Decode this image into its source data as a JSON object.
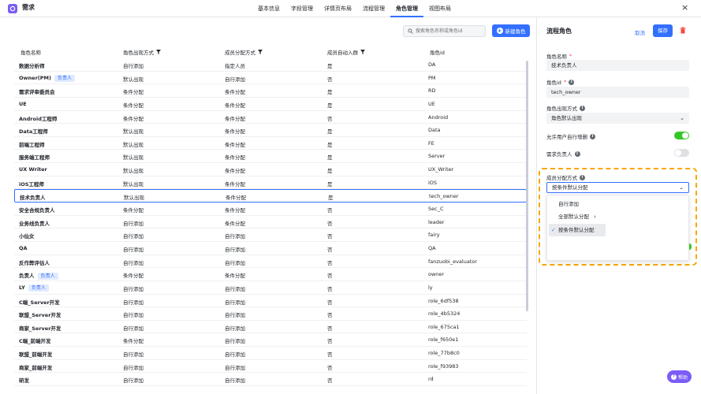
{
  "app": {
    "title": "需求"
  },
  "tabs": [
    {
      "label": "基本信息"
    },
    {
      "label": "字段管理"
    },
    {
      "label": "详情页布局"
    },
    {
      "label": "流程管理"
    },
    {
      "label": "角色管理"
    },
    {
      "label": "视图布局"
    }
  ],
  "active_tab": "角色管理",
  "toolbar": {
    "search_placeholder": "搜索角色名称或角色id",
    "new_role_label": "新建角色"
  },
  "table": {
    "columns": [
      "角色名称",
      "角色出现方式",
      "成员分配方式",
      "成员自动入群",
      "角色id"
    ],
    "rows": [
      {
        "name": "数据分析师",
        "tag": "",
        "appear": "自行添加",
        "assign": "指定人员",
        "auto": "是",
        "id": "DA"
      },
      {
        "name": "Owner(PM)",
        "tag": "负责人",
        "appear": "默认出现",
        "assign": "自行添加",
        "auto": "否",
        "id": "PM"
      },
      {
        "name": "需求评审委员会",
        "tag": "",
        "appear": "条件分配",
        "assign": "条件分配",
        "auto": "是",
        "id": "RD"
      },
      {
        "name": "UE",
        "tag": "",
        "appear": "条件分配",
        "assign": "条件分配",
        "auto": "是",
        "id": "UE"
      },
      {
        "name": "Android工程师",
        "tag": "",
        "appear": "条件分配",
        "assign": "条件分配",
        "auto": "否",
        "id": "Android"
      },
      {
        "name": "Data工程师",
        "tag": "",
        "appear": "默认出现",
        "assign": "条件分配",
        "auto": "是",
        "id": "Data"
      },
      {
        "name": "前端工程师",
        "tag": "",
        "appear": "默认出现",
        "assign": "条件分配",
        "auto": "是",
        "id": "FE"
      },
      {
        "name": "服务端工程师",
        "tag": "",
        "appear": "默认出现",
        "assign": "条件分配",
        "auto": "是",
        "id": "Server"
      },
      {
        "name": "UX Writer",
        "tag": "",
        "appear": "默认出现",
        "assign": "条件分配",
        "auto": "是",
        "id": "UX_Writer"
      },
      {
        "name": "iOS工程师",
        "tag": "",
        "appear": "默认出现",
        "assign": "条件分配",
        "auto": "是",
        "id": "iOS"
      },
      {
        "name": "技术负责人",
        "tag": "",
        "appear": "默认出现",
        "assign": "条件分配",
        "auto": "是",
        "id": "tech_owner",
        "selected": true
      },
      {
        "name": "安全合规负责人",
        "tag": "",
        "appear": "条件分配",
        "assign": "条件分配",
        "auto": "否",
        "id": "Sec_C"
      },
      {
        "name": "业务线负责人",
        "tag": "",
        "appear": "自行添加",
        "assign": "条件分配",
        "auto": "否",
        "id": "leader"
      },
      {
        "name": "小仙女",
        "tag": "",
        "appear": "自行添加",
        "assign": "自行添加",
        "auto": "否",
        "id": "fairy"
      },
      {
        "name": "QA",
        "tag": "",
        "appear": "自行添加",
        "assign": "自行添加",
        "auto": "否",
        "id": "QA"
      },
      {
        "name": "反作弊评估人",
        "tag": "",
        "appear": "自行添加",
        "assign": "自行添加",
        "auto": "否",
        "id": "fanzuobi_evaluator"
      },
      {
        "name": "负责人",
        "tag": "负责人",
        "appear": "条件分配",
        "assign": "条件分配",
        "auto": "否",
        "id": "owner"
      },
      {
        "name": "LY",
        "tag": "负责人",
        "appear": "自行添加",
        "assign": "自行添加",
        "auto": "否",
        "id": "ly"
      },
      {
        "name": "C端_Server开发",
        "tag": "",
        "appear": "自行添加",
        "assign": "自行添加",
        "auto": "否",
        "id": "role_6df538"
      },
      {
        "name": "联盟_Server开发",
        "tag": "",
        "appear": "自行添加",
        "assign": "自行添加",
        "auto": "否",
        "id": "role_4b5324"
      },
      {
        "name": "商家_Server开发",
        "tag": "",
        "appear": "自行添加",
        "assign": "自行添加",
        "auto": "否",
        "id": "role_675ca1"
      },
      {
        "name": "C端_前端开发",
        "tag": "",
        "appear": "条件分配",
        "assign": "自行添加",
        "auto": "否",
        "id": "role_f650e1"
      },
      {
        "name": "联盟_前端开发",
        "tag": "",
        "appear": "自行添加",
        "assign": "自行添加",
        "auto": "否",
        "id": "role_77b8c0"
      },
      {
        "name": "商家_前端开发",
        "tag": "",
        "appear": "自行添加",
        "assign": "自行添加",
        "auto": "否",
        "id": "role_f93983"
      },
      {
        "name": "研发",
        "tag": "",
        "appear": "自行添加",
        "assign": "自行添加",
        "auto": "否",
        "id": "rd"
      }
    ]
  },
  "panel": {
    "title": "流程角色",
    "cancel_label": "取消",
    "save_label": "保存",
    "role_name_label": "角色名称",
    "role_name_value": "技术负责人",
    "role_id_label": "角色id",
    "role_id_value": "tech_owner",
    "appear_label": "角色出现方式",
    "appear_value": "角色默认出现",
    "allow_delete_label": "允许用户自行增删",
    "allow_delete_on": true,
    "owner_label": "需求负责人",
    "owner_on": false,
    "assign_label": "成员分配方式",
    "assign_value": "按条件默认分配",
    "assign_options": [
      {
        "label": "自行添加"
      },
      {
        "label": "全部默认分配"
      },
      {
        "label": "按条件默认分配"
      }
    ],
    "assign_selected": "按条件默认分配",
    "required_mark": "*",
    "info_glyph": "i"
  },
  "help_label": "帮助",
  "colors": {
    "accent": "#3370ff",
    "brand": "#7b5cf5",
    "highlight": "#f7a800",
    "toggle_on": "#34c724"
  }
}
